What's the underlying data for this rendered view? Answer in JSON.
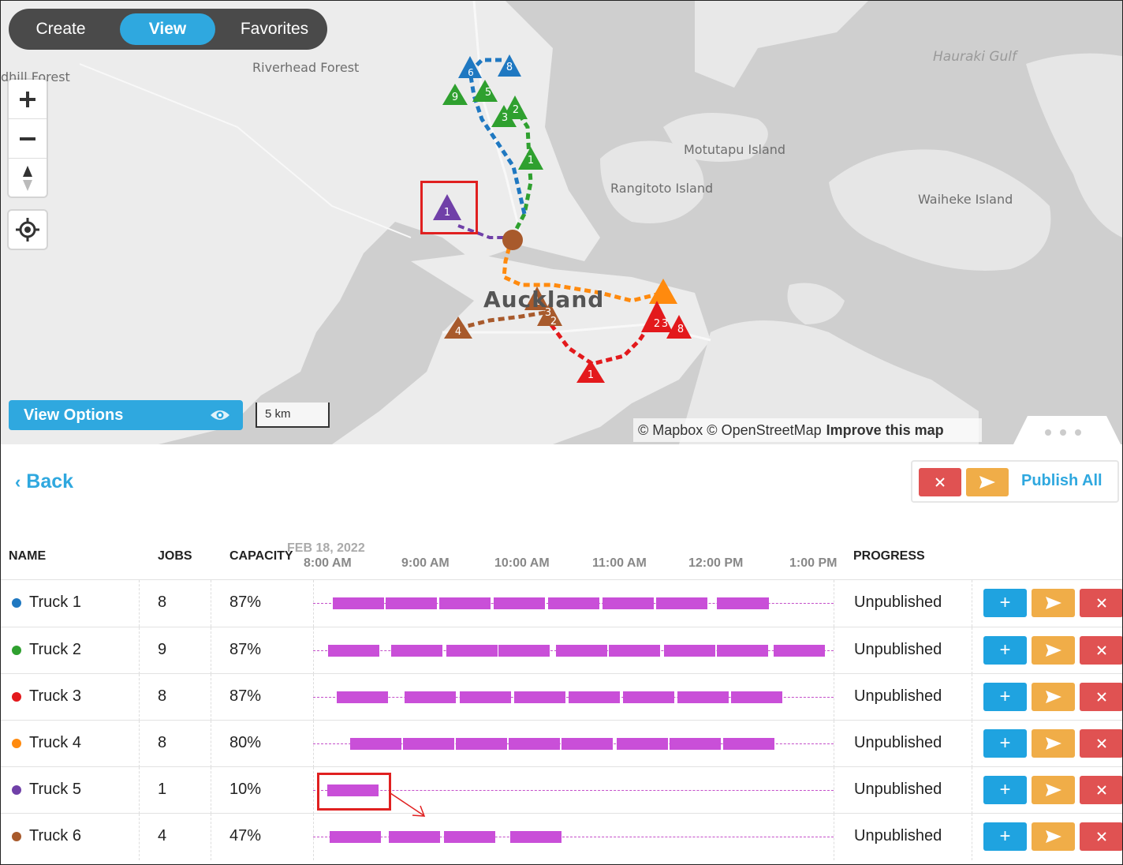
{
  "tabs": [
    {
      "label": "Create",
      "active": false
    },
    {
      "label": "View",
      "active": true
    },
    {
      "label": "Favorites",
      "active": false
    }
  ],
  "map": {
    "labels": {
      "riverhead": "Riverhead Forest",
      "redhill": "dhill Forest",
      "hauraki": "Hauraki Gulf",
      "motutapu": "Motutapu Island",
      "rangitoto": "Rangitoto Island",
      "waiheke": "Waiheke Island",
      "auckland": "Auckland"
    },
    "zoom_in_icon": "plus-icon",
    "zoom_out_icon": "minus-icon",
    "compass_icon": "compass-icon",
    "locate_icon": "geolocate-icon",
    "view_options_label": "View Options",
    "view_options_icon": "eye-icon",
    "scale_label": "5 km",
    "attribution": "© Mapbox © OpenStreetMap",
    "attribution_link": "Improve this map",
    "panel_handle_icon": "more-dots-icon"
  },
  "panel": {
    "back_label": "Back",
    "publish_all_label": "Publish All",
    "columns": {
      "name": "NAME",
      "jobs": "JOBS",
      "capacity": "CAPACITY",
      "progress": "PROGRESS"
    },
    "date_label": "FEB 18, 2022",
    "time_ticks": [
      "8:00 AM",
      "9:00 AM",
      "10:00 AM",
      "11:00 AM",
      "12:00 PM",
      "1:00 PM"
    ],
    "rows": [
      {
        "name": "Truck 1",
        "jobs": "8",
        "capacity": "87%",
        "progress": "Unpublished",
        "color": "#1f78c1"
      },
      {
        "name": "Truck 2",
        "jobs": "9",
        "capacity": "87%",
        "progress": "Unpublished",
        "color": "#2fa02f"
      },
      {
        "name": "Truck 3",
        "jobs": "8",
        "capacity": "87%",
        "progress": "Unpublished",
        "color": "#e3191c"
      },
      {
        "name": "Truck 4",
        "jobs": "8",
        "capacity": "80%",
        "progress": "Unpublished",
        "color": "#ff8a0e"
      },
      {
        "name": "Truck 5",
        "jobs": "1",
        "capacity": "10%",
        "progress": "Unpublished",
        "color": "#7040a8"
      },
      {
        "name": "Truck 6",
        "jobs": "4",
        "capacity": "47%",
        "progress": "Unpublished",
        "color": "#a85a2c"
      }
    ]
  },
  "colors": {
    "accent": "#2fa8df",
    "timeline_bar": "#c94fd8",
    "add": "#1fa3e0",
    "send": "#f0ad48",
    "delete": "#e05252",
    "highlight": "#e02020"
  }
}
